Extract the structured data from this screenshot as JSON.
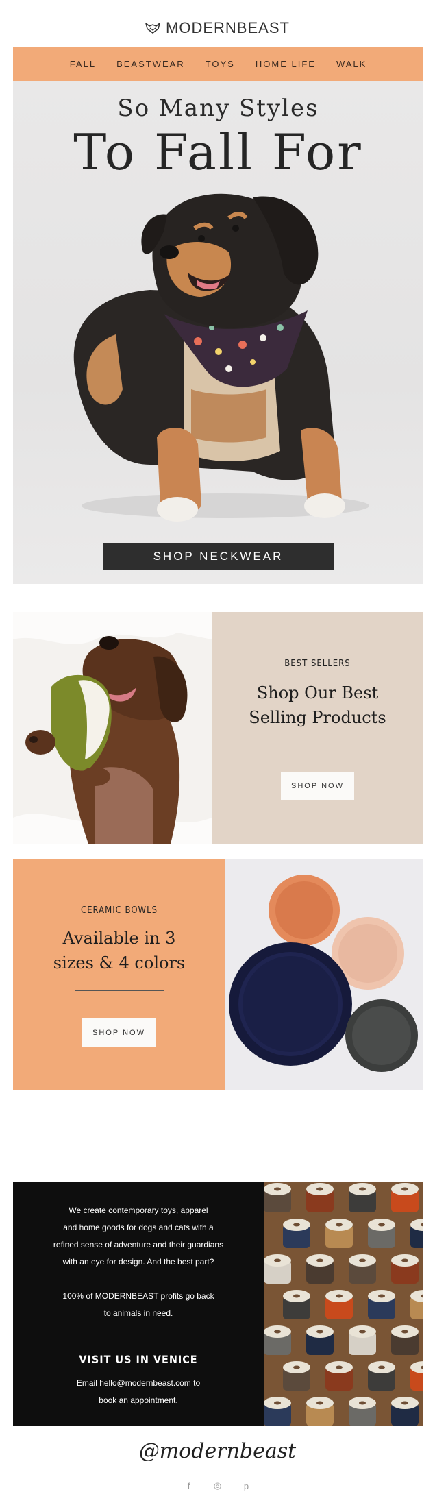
{
  "brand": {
    "name": "MODERNBEAST"
  },
  "nav": {
    "items": [
      {
        "label": "FALL"
      },
      {
        "label": "BEASTWEAR"
      },
      {
        "label": "TOYS"
      },
      {
        "label": "HOME LIFE"
      },
      {
        "label": "WALK"
      }
    ]
  },
  "hero": {
    "line1": "So Many Styles",
    "line2": "To Fall For",
    "button": "SHOP NECKWEAR"
  },
  "bestsellers": {
    "kicker": "BEST SELLERS",
    "heading_line1": "Shop Our Best",
    "heading_line2": "Selling Products",
    "button": "SHOP NOW"
  },
  "bowls": {
    "kicker": "CERAMIC BOWLS",
    "heading_line1": "Available in 3",
    "heading_line2": "sizes & 4 colors",
    "button": "SHOP NOW"
  },
  "about": {
    "p1_l1": "We create contemporary toys, apparel",
    "p1_l2": "and home goods for dogs and cats with a",
    "p1_l3": "refined sense of adventure and their guardians",
    "p1_l4": "with an eye for design.  And the best part?",
    "p2_l1": "100% of MODERNBEAST profits go back",
    "p2_l2": "to animals in need.",
    "heading": "VISIT US IN VENICE",
    "p3_l1": "Email hello@modernbeast.com to",
    "p3_l2": "book an appointment."
  },
  "footer": {
    "handle": "@modernbeast",
    "social": [
      {
        "icon": "facebook-icon",
        "glyph": "f"
      },
      {
        "icon": "instagram-icon",
        "glyph": "◎"
      },
      {
        "icon": "pinterest-icon",
        "glyph": "p"
      }
    ]
  },
  "colors": {
    "accent_orange": "#f2aa78",
    "panel_beige": "#e2d4c7",
    "dark": "#0e0e0e",
    "button_dark": "#2e2e2e"
  }
}
